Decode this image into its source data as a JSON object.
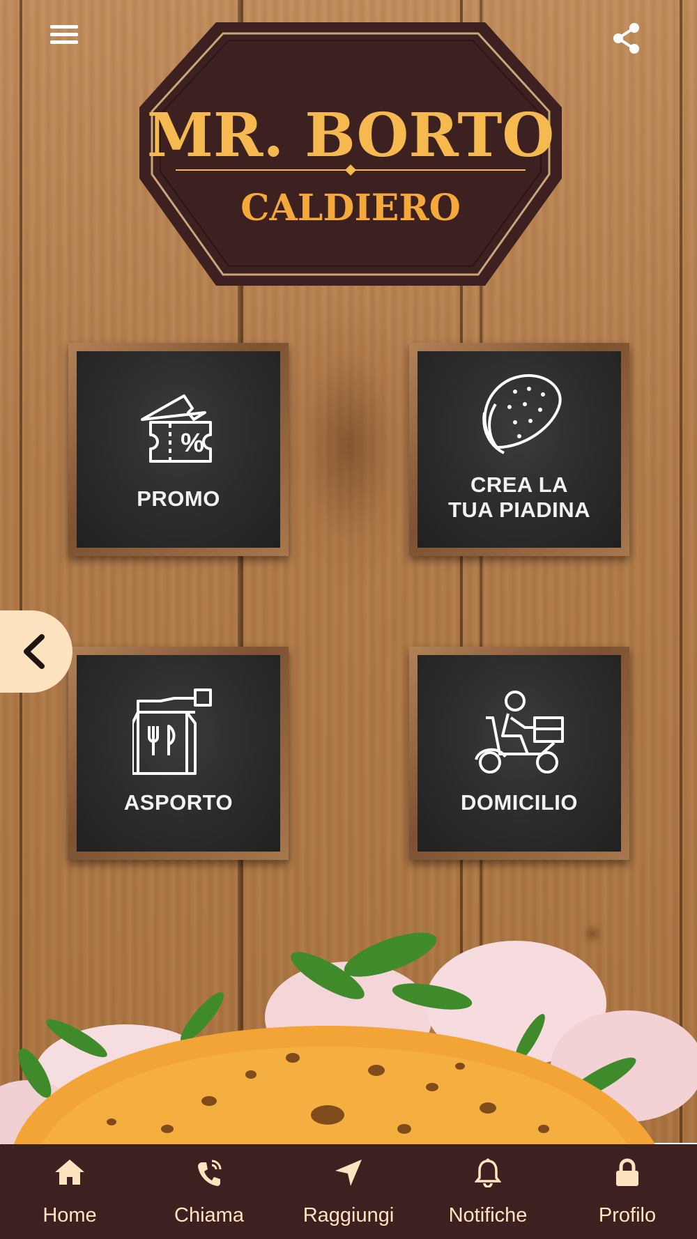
{
  "header": {
    "menu_icon": "hamburger-menu-icon",
    "share_icon": "share-icon"
  },
  "logo": {
    "title": "MR. BORTO",
    "subtitle": "CALDIERO",
    "colors": {
      "badge": "#3d2120",
      "text": "#f6b94f",
      "subtitle": "#f4a93a"
    }
  },
  "tiles": [
    {
      "label": "PROMO",
      "icon": "ticket-percent-icon"
    },
    {
      "label_line1": "CREA LA",
      "label_line2": "TUA PIADINA",
      "icon": "piadina-icon"
    },
    {
      "label": "ASPORTO",
      "icon": "takeaway-bag-icon"
    },
    {
      "label": "DOMICILIO",
      "icon": "delivery-scooter-icon"
    }
  ],
  "side_tab": {
    "icon": "chevron-left-icon"
  },
  "nav": [
    {
      "label": "Home",
      "icon": "home-icon"
    },
    {
      "label": "Chiama",
      "icon": "phone-icon"
    },
    {
      "label": "Raggiungi",
      "icon": "navigation-arrow-icon"
    },
    {
      "label": "Notifiche",
      "icon": "bell-icon"
    },
    {
      "label": "Profilo",
      "icon": "lock-icon"
    }
  ],
  "colors": {
    "navbar_bg": "#3d2120",
    "nav_text": "#fde3bf",
    "tile_label": "#f2f2f2"
  }
}
